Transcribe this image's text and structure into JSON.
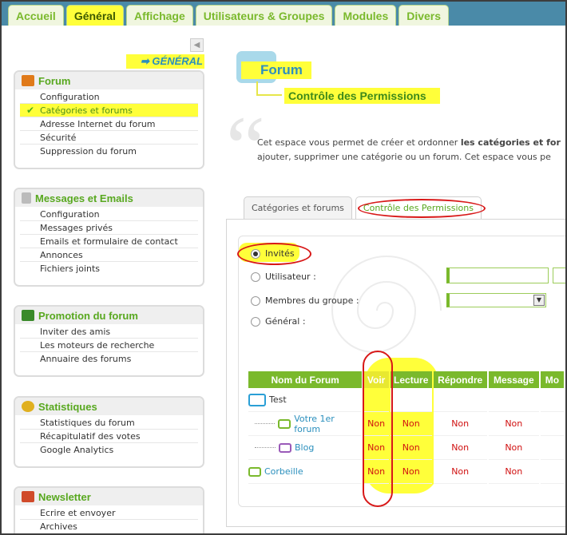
{
  "tabs": [
    "Accueil",
    "Général",
    "Affichage",
    "Utilisateurs & Groupes",
    "Modules",
    "Divers"
  ],
  "active_tab": "Général",
  "sidebar": {
    "heading": "➡ GÉNÉRAL",
    "collapse_icon": "triangle-left-icon",
    "boxes": [
      {
        "title": "Forum",
        "icon": "wrench-icon",
        "items": [
          "Configuration",
          "Catégories et forums",
          "Adresse Internet du forum",
          "Sécurité",
          "Suppression du forum"
        ]
      },
      {
        "title": "Messages et Emails",
        "icon": "document-icon",
        "items": [
          "Configuration",
          "Messages privés",
          "Emails et formulaire de contact",
          "Annonces",
          "Fichiers joints"
        ]
      },
      {
        "title": "Promotion du forum",
        "icon": "megaphone-icon",
        "items": [
          "Inviter des amis",
          "Les moteurs de recherche",
          "Annuaire des forums"
        ]
      },
      {
        "title": "Statistiques",
        "icon": "pie-chart-icon",
        "items": [
          "Statistiques du forum",
          "Récapitulatif des votes",
          "Google Analytics"
        ]
      },
      {
        "title": "Newsletter",
        "icon": "envelope-icon",
        "items": [
          "Ecrire et envoyer",
          "Archives"
        ]
      }
    ]
  },
  "page": {
    "title": "Forum",
    "subtitle": "Contrôle des Permissions",
    "intro_line1_a": "Cet espace vous permet de créer et ordonner ",
    "intro_line1_b": "les catégories et for",
    "intro_line2": "ajouter, supprimer une catégorie ou un forum. Cet espace vous pe"
  },
  "panel_tabs": [
    "Catégories et forums",
    "Contrôle des Permissions"
  ],
  "permissions": {
    "options": [
      "Invités",
      "Utilisateur :",
      "Membres du groupe :",
      "Général :"
    ],
    "selected": "Invités"
  },
  "table": {
    "headers": [
      "Nom du Forum",
      "Voir",
      "Lecture",
      "Répondre",
      "Message",
      "Mo"
    ],
    "rows": [
      {
        "name": "Test",
        "level": 0,
        "icon": "blue-chat-icon",
        "values": [
          "",
          "",
          "",
          "",
          ""
        ]
      },
      {
        "name": "Votre 1er forum",
        "level": 1,
        "icon": "green-chat-icon",
        "values": [
          "Non",
          "Non",
          "Non",
          "Non",
          ""
        ]
      },
      {
        "name": "Blog",
        "level": 1,
        "icon": "purple-chat-icon",
        "values": [
          "Non",
          "Non",
          "Non",
          "Non",
          ""
        ]
      },
      {
        "name": "Corbeille",
        "level": 0,
        "icon": "green-chat-icon",
        "values": [
          "Non",
          "Non",
          "Non",
          "Non",
          ""
        ]
      }
    ]
  },
  "colors": {
    "accent": "#7ab92c",
    "highlight": "#ffff3a",
    "link": "#2a8fbd",
    "no": "#d01010"
  }
}
